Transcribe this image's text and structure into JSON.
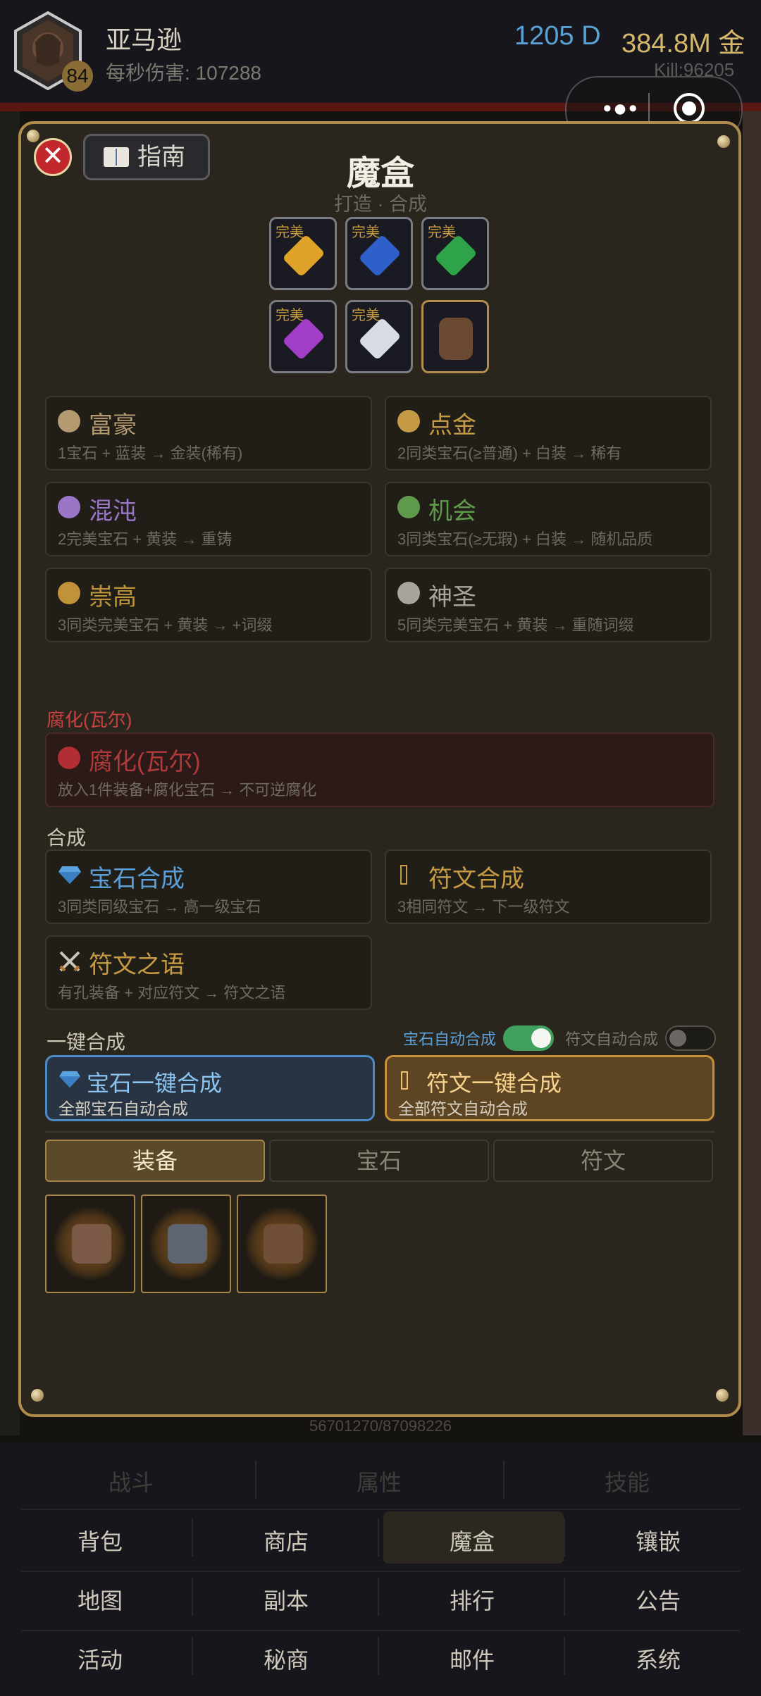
{
  "player": {
    "name": "亚马逊",
    "level": "84",
    "dps_label": "每秒伤害: 107288",
    "diamonds": "1205 D",
    "gold": "384.8M 金",
    "kills": "Kill:96205"
  },
  "modal": {
    "guide_label": "指南",
    "close_label": "✕",
    "title": "魔盒",
    "subtitle": "打造 · 合成",
    "perfect_label": "完美",
    "gems": [
      {
        "name": "topaz",
        "color": "#e0a32a"
      },
      {
        "name": "sapphire",
        "color": "#2f5fc9"
      },
      {
        "name": "emerald",
        "color": "#2ea34a"
      },
      {
        "name": "amethyst",
        "color": "#a33ec9"
      },
      {
        "name": "diamond",
        "color": "#d9dde3"
      },
      {
        "name": "gloves",
        "color": "#6b4a33"
      }
    ],
    "recipes": [
      {
        "title": "富豪",
        "desc": "1宝石 + 蓝装 → 金装(稀有)",
        "color": "#b39a70",
        "icon": "money-bag-icon"
      },
      {
        "title": "点金",
        "desc": "2同类宝石(≥普通) + 白装 → 稀有",
        "color": "#c59a44",
        "icon": "gold-orb-icon"
      },
      {
        "title": "混沌",
        "desc": "2完美宝石 + 黄装 → 重铸",
        "color": "#9a76c7",
        "icon": "purple-orb-icon"
      },
      {
        "title": "机会",
        "desc": "3同类宝石(≥无瑕) + 白装 → 随机品质",
        "color": "#5f9a4c",
        "icon": "green-orb-icon"
      },
      {
        "title": "崇高",
        "desc": "3同类完美宝石 + 黄装 → +词缀",
        "color": "#c0923a",
        "icon": "orange-orb-icon"
      },
      {
        "title": "神圣",
        "desc": "5同类完美宝石 + 黄装 → 重随词缀",
        "color": "#a9a59c",
        "icon": "gray-orb-icon"
      }
    ],
    "corrupt": {
      "section": "腐化(瓦尔)",
      "title": "腐化(瓦尔)",
      "desc": "放入1件装备+腐化宝石 → 不可逆腐化",
      "color": "#b03a3a"
    },
    "synth": {
      "section": "合成",
      "gem": {
        "title": "宝石合成",
        "desc": "3同类同级宝石 → 高一级宝石",
        "color": "#5ca0da"
      },
      "rune": {
        "title": "符文合成",
        "desc": "3相同符文 → 下一级符文",
        "color": "#c79a44"
      },
      "word": {
        "title": "符文之语",
        "desc": "有孔装备 + 对应符文 → 符文之语",
        "color": "#c79a44"
      }
    },
    "oneclick": {
      "section": "一键合成",
      "gem_toggle_label": "宝石自动合成",
      "rune_toggle_label": "符文自动合成",
      "gem_toggle_on": true,
      "rune_toggle_on": false,
      "gem_btn": {
        "title": "宝石一键合成",
        "desc": "全部宝石自动合成"
      },
      "rune_btn": {
        "title": "符文一键合成",
        "desc": "全部符文自动合成"
      }
    },
    "tabs": [
      "装备",
      "宝石",
      "符文"
    ],
    "active_tab": "装备",
    "items": [
      {
        "name": "bracers",
        "color": "#7a5a46"
      },
      {
        "name": "chest-armor",
        "color": "#5f6570"
      },
      {
        "name": "gloves",
        "color": "#6e4e36"
      }
    ],
    "bottom_text": "56701270/87098226"
  },
  "nav": {
    "dim_row": [
      "战斗",
      "属性",
      "技能"
    ],
    "rows": [
      [
        "背包",
        "商店",
        "魔盒",
        "镶嵌"
      ],
      [
        "地图",
        "副本",
        "排行",
        "公告"
      ],
      [
        "活动",
        "秘商",
        "邮件",
        "系统"
      ]
    ],
    "active": "魔盒"
  }
}
